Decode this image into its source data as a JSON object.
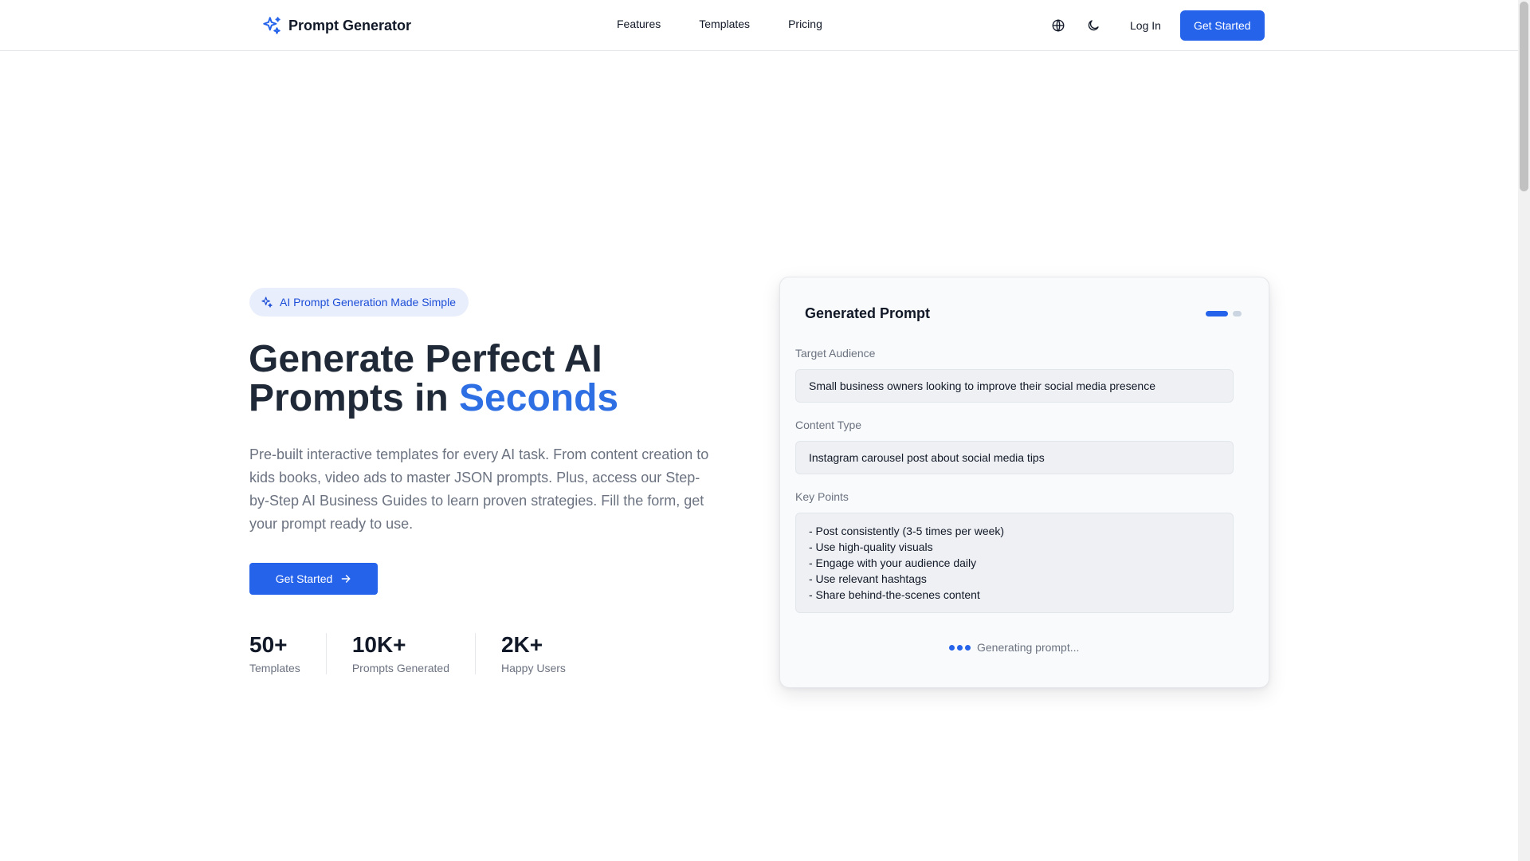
{
  "header": {
    "logo_text": "Prompt Generator",
    "nav": [
      {
        "label": "Features"
      },
      {
        "label": "Templates"
      },
      {
        "label": "Pricing"
      }
    ],
    "icons": [
      "globe-icon",
      "moon-icon"
    ],
    "login_label": "Log In",
    "cta_label": "Get Started"
  },
  "hero": {
    "badge": "AI Prompt Generation Made Simple",
    "title_line1": "Generate Perfect AI",
    "title_line2_prefix": "Prompts in ",
    "title_highlight": "Seconds",
    "description": "Pre-built interactive templates for every AI task. From content creation to kids books, video ads to master JSON prompts. Plus, access our Step-by-Step AI Business Guides to learn proven strategies. Fill the form, get your prompt ready to use.",
    "cta_label": "Get Started",
    "stats": [
      {
        "value": "50+",
        "label": "Templates"
      },
      {
        "value": "10K+",
        "label": "Prompts Generated"
      },
      {
        "value": "2K+",
        "label": "Happy Users"
      }
    ]
  },
  "card": {
    "title": "Generated Prompt",
    "fields": {
      "target_audience_label": "Target Audience",
      "target_audience_value": "Small business owners looking to improve their social media presence",
      "content_type_label": "Content Type",
      "content_type_value": "Instagram carousel post about social media tips",
      "key_points_label": "Key Points",
      "key_points": [
        "- Post consistently (3-5 times per week)",
        "- Use high-quality visuals",
        "- Engage with your audience daily",
        "- Use relevant hashtags",
        "- Share behind-the-scenes content"
      ]
    },
    "status_text": "Generating prompt..."
  },
  "colors": {
    "accent": "#2563eb",
    "highlight": "#2f6fe4",
    "badge_bg": "#e8eefb"
  }
}
